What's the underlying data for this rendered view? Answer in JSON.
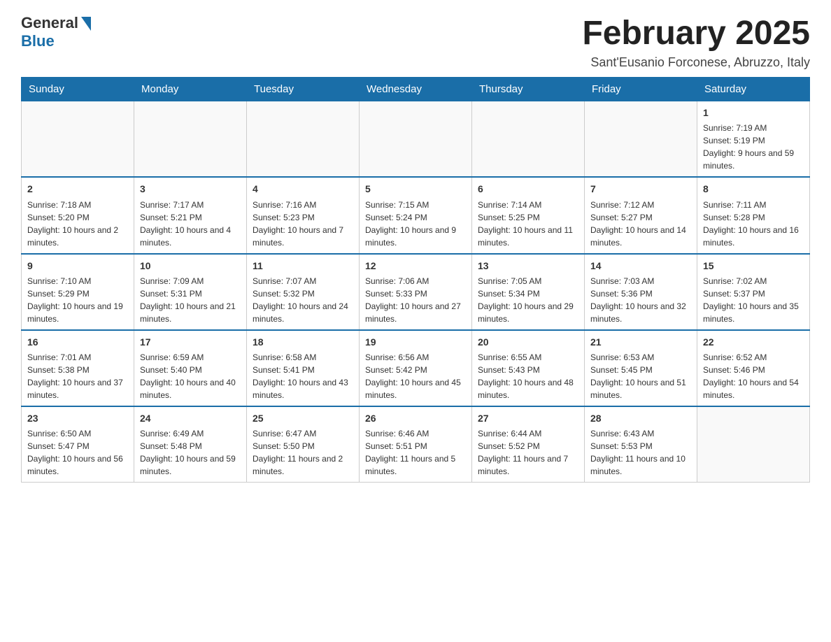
{
  "logo": {
    "general": "General",
    "blue": "Blue"
  },
  "title": "February 2025",
  "subtitle": "Sant'Eusanio Forconese, Abruzzo, Italy",
  "days_of_week": [
    "Sunday",
    "Monday",
    "Tuesday",
    "Wednesday",
    "Thursday",
    "Friday",
    "Saturday"
  ],
  "weeks": [
    [
      {
        "day": "",
        "info": ""
      },
      {
        "day": "",
        "info": ""
      },
      {
        "day": "",
        "info": ""
      },
      {
        "day": "",
        "info": ""
      },
      {
        "day": "",
        "info": ""
      },
      {
        "day": "",
        "info": ""
      },
      {
        "day": "1",
        "info": "Sunrise: 7:19 AM\nSunset: 5:19 PM\nDaylight: 9 hours and 59 minutes."
      }
    ],
    [
      {
        "day": "2",
        "info": "Sunrise: 7:18 AM\nSunset: 5:20 PM\nDaylight: 10 hours and 2 minutes."
      },
      {
        "day": "3",
        "info": "Sunrise: 7:17 AM\nSunset: 5:21 PM\nDaylight: 10 hours and 4 minutes."
      },
      {
        "day": "4",
        "info": "Sunrise: 7:16 AM\nSunset: 5:23 PM\nDaylight: 10 hours and 7 minutes."
      },
      {
        "day": "5",
        "info": "Sunrise: 7:15 AM\nSunset: 5:24 PM\nDaylight: 10 hours and 9 minutes."
      },
      {
        "day": "6",
        "info": "Sunrise: 7:14 AM\nSunset: 5:25 PM\nDaylight: 10 hours and 11 minutes."
      },
      {
        "day": "7",
        "info": "Sunrise: 7:12 AM\nSunset: 5:27 PM\nDaylight: 10 hours and 14 minutes."
      },
      {
        "day": "8",
        "info": "Sunrise: 7:11 AM\nSunset: 5:28 PM\nDaylight: 10 hours and 16 minutes."
      }
    ],
    [
      {
        "day": "9",
        "info": "Sunrise: 7:10 AM\nSunset: 5:29 PM\nDaylight: 10 hours and 19 minutes."
      },
      {
        "day": "10",
        "info": "Sunrise: 7:09 AM\nSunset: 5:31 PM\nDaylight: 10 hours and 21 minutes."
      },
      {
        "day": "11",
        "info": "Sunrise: 7:07 AM\nSunset: 5:32 PM\nDaylight: 10 hours and 24 minutes."
      },
      {
        "day": "12",
        "info": "Sunrise: 7:06 AM\nSunset: 5:33 PM\nDaylight: 10 hours and 27 minutes."
      },
      {
        "day": "13",
        "info": "Sunrise: 7:05 AM\nSunset: 5:34 PM\nDaylight: 10 hours and 29 minutes."
      },
      {
        "day": "14",
        "info": "Sunrise: 7:03 AM\nSunset: 5:36 PM\nDaylight: 10 hours and 32 minutes."
      },
      {
        "day": "15",
        "info": "Sunrise: 7:02 AM\nSunset: 5:37 PM\nDaylight: 10 hours and 35 minutes."
      }
    ],
    [
      {
        "day": "16",
        "info": "Sunrise: 7:01 AM\nSunset: 5:38 PM\nDaylight: 10 hours and 37 minutes."
      },
      {
        "day": "17",
        "info": "Sunrise: 6:59 AM\nSunset: 5:40 PM\nDaylight: 10 hours and 40 minutes."
      },
      {
        "day": "18",
        "info": "Sunrise: 6:58 AM\nSunset: 5:41 PM\nDaylight: 10 hours and 43 minutes."
      },
      {
        "day": "19",
        "info": "Sunrise: 6:56 AM\nSunset: 5:42 PM\nDaylight: 10 hours and 45 minutes."
      },
      {
        "day": "20",
        "info": "Sunrise: 6:55 AM\nSunset: 5:43 PM\nDaylight: 10 hours and 48 minutes."
      },
      {
        "day": "21",
        "info": "Sunrise: 6:53 AM\nSunset: 5:45 PM\nDaylight: 10 hours and 51 minutes."
      },
      {
        "day": "22",
        "info": "Sunrise: 6:52 AM\nSunset: 5:46 PM\nDaylight: 10 hours and 54 minutes."
      }
    ],
    [
      {
        "day": "23",
        "info": "Sunrise: 6:50 AM\nSunset: 5:47 PM\nDaylight: 10 hours and 56 minutes."
      },
      {
        "day": "24",
        "info": "Sunrise: 6:49 AM\nSunset: 5:48 PM\nDaylight: 10 hours and 59 minutes."
      },
      {
        "day": "25",
        "info": "Sunrise: 6:47 AM\nSunset: 5:50 PM\nDaylight: 11 hours and 2 minutes."
      },
      {
        "day": "26",
        "info": "Sunrise: 6:46 AM\nSunset: 5:51 PM\nDaylight: 11 hours and 5 minutes."
      },
      {
        "day": "27",
        "info": "Sunrise: 6:44 AM\nSunset: 5:52 PM\nDaylight: 11 hours and 7 minutes."
      },
      {
        "day": "28",
        "info": "Sunrise: 6:43 AM\nSunset: 5:53 PM\nDaylight: 11 hours and 10 minutes."
      },
      {
        "day": "",
        "info": ""
      }
    ]
  ]
}
